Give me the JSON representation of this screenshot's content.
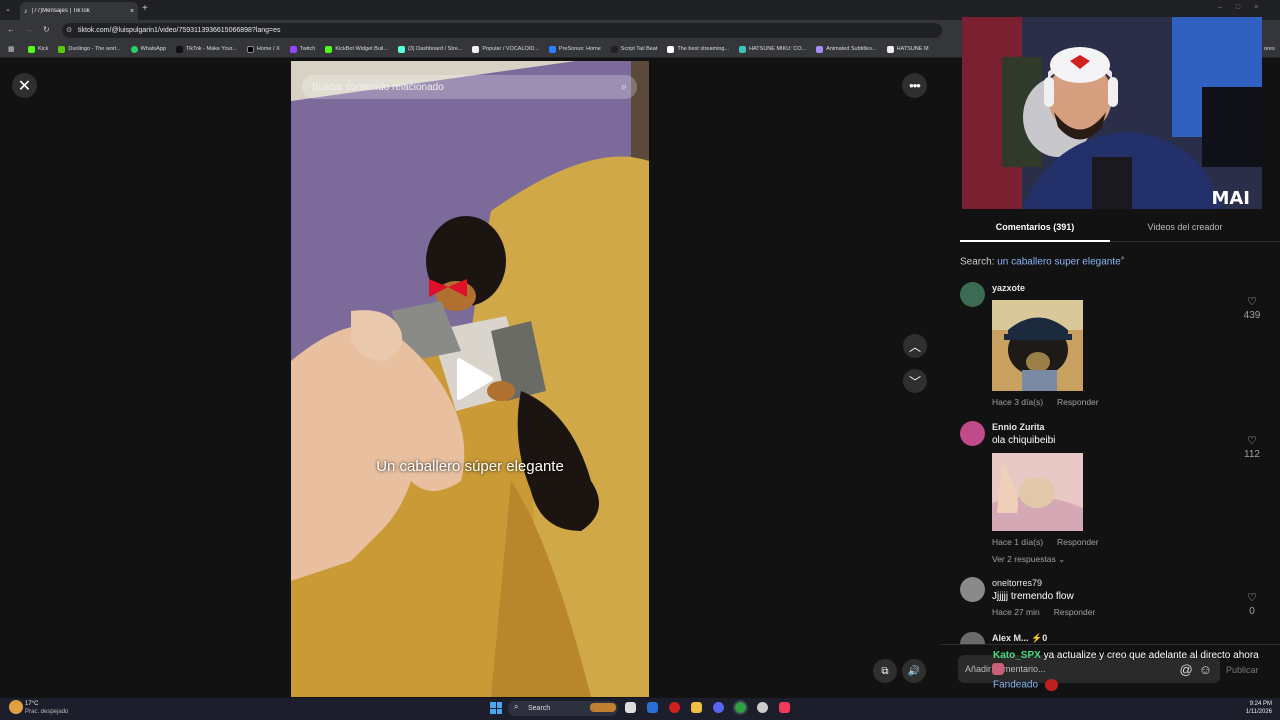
{
  "browser": {
    "tab_title": "(77)Mensajes | TikTok",
    "url": "tiktok.com/@luispulgarin1/video/7593113936615066898?lang=es",
    "bookmarks": [
      "Kick",
      "Duolingo - The worl...",
      "WhatsApp",
      "TikTok - Make Your...",
      "Home / X",
      "Twitch",
      "KickBot Widget Buil...",
      "(3) Dashboard / Stre...",
      "Popular / VOCALOID...",
      "PreSonus: Home",
      "Script Tail Beat",
      "The best streaming...",
      "HATSUNE MIKU: CO...",
      "Animated Subtitles...",
      "HATSUNE M"
    ],
    "overflow_label": "ores"
  },
  "video": {
    "search_placeholder": "Buscar contenido relacionado",
    "caption": "Un caballero súper elegante"
  },
  "panel": {
    "tab_comments": "Comentarios (391)",
    "tab_creator": "Videos del creador",
    "search_prefix": "Search: ",
    "search_term": "un caballero super elegante",
    "comments": [
      {
        "user": "yazxote",
        "text": "",
        "time": "Hace 3 día(s)",
        "reply": "Responder",
        "likes": "439"
      },
      {
        "user": "Ennio Zurita",
        "text": "ola chiquibeibi",
        "time": "Hace 1 día(s)",
        "reply": "Responder",
        "likes": "112",
        "replies": "Ver 2 respuestas"
      },
      {
        "user": "oneltorres79",
        "text": "Jjjjjj tremendo flow",
        "time": "Hace 27 min",
        "reply": "Responder",
        "likes": "0"
      },
      {
        "user": "Alex M... ⚡0",
        "text": "",
        "time": "",
        "reply": "",
        "likes": ""
      }
    ],
    "input_placeholder": "Añadir comentario...",
    "publish": "Publicar"
  },
  "overlay_chat": {
    "user": "Kato_SPX",
    "message": "ya actualize y creo que adelante al directo ahora",
    "line2": "Fandeado"
  },
  "webcam": {
    "watermark": "MAI"
  },
  "taskbar": {
    "weather_temp": "17°C",
    "weather_desc": "Prac. despejado",
    "search": "Search",
    "time": "9:24 PM",
    "date": "1/11/2026"
  },
  "colors": {
    "accent_link": "#8ab4f8",
    "chat_user": "#4ade80",
    "page_bg": "#121212"
  }
}
